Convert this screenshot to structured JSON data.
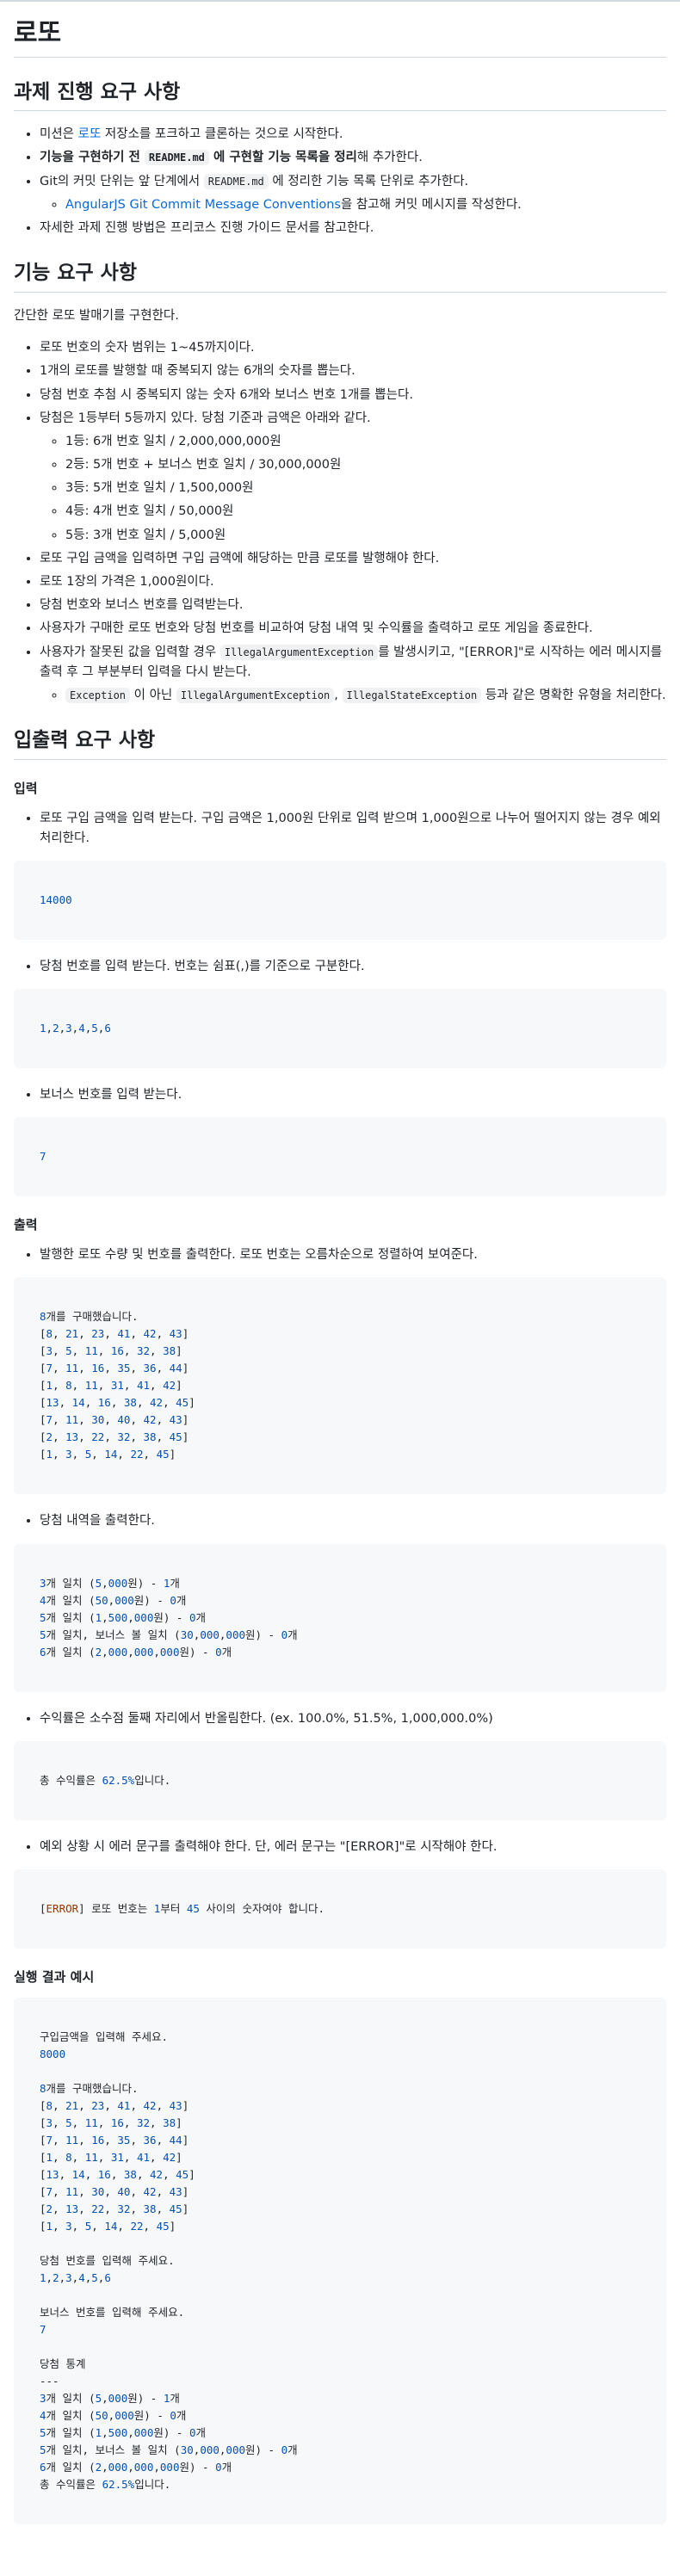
{
  "title": "로또",
  "section1": {
    "heading": "과제 진행 요구 사항",
    "items": [
      {
        "pre": "미션은 ",
        "link": "로또",
        "post": " 저장소를 포크하고 클론하는 것으로 시작한다."
      },
      {
        "pre": "기능을 구현하기 전 ",
        "code": "README.md",
        "post": " 에 구현할 기능 목록을 정리",
        "tail": "해 추가한다."
      },
      {
        "pre": "Git의 커밋 단위는 앞 단계에서 ",
        "code": "README.md",
        "post": " 에 정리한 기능 목록 단위로 추가한다."
      },
      {
        "link": "AngularJS Git Commit Message Conventions",
        "post": "을 참고해 커밋 메시지를 작성한다."
      },
      {
        "text": "자세한 과제 진행 방법은 프리코스 진행 가이드 문서를 참고한다."
      }
    ]
  },
  "section2": {
    "heading": "기능 요구 사항",
    "intro": "간단한 로또 발매기를 구현한다.",
    "items": [
      "로또 번호의 숫자 범위는 1~45까지이다.",
      "1개의 로또를 발행할 때 중복되지 않는 6개의 숫자를 뽑는다.",
      "당첨 번호 추첨 시 중복되지 않는 숫자 6개와 보너스 번호 1개를 뽑는다.",
      "당첨은 1등부터 5등까지 있다. 당첨 기준과 금액은 아래와 같다.",
      "로또 구입 금액을 입력하면 구입 금액에 해당하는 만큼 로또를 발행해야 한다.",
      "로또 1장의 가격은 1,000원이다.",
      "당첨 번호와 보너스 번호를 입력받는다.",
      "사용자가 구매한 로또 번호와 당첨 번호를 비교하여 당첨 내역 및 수익률을 출력하고 로또 게임을 종료한다.",
      "사용자가 잘못된 값을 입력할 경우 ",
      "IllegalArgumentException",
      "를 발생시키고, \"[ERROR]\"로 시작하는 에러 메시지를 출력 후 그 부분부터 입력을 다시 받는다."
    ],
    "prizes": [
      "1등: 6개 번호 일치 / 2,000,000,000원",
      "2등: 5개 번호 + 보너스 번호 일치 / 30,000,000원",
      "3등: 5개 번호 일치 / 1,500,000원",
      "4등: 4개 번호 일치 / 50,000원",
      "5등: 3개 번호 일치 / 5,000원"
    ],
    "exception_note": {
      "code1": "Exception",
      "mid1": " 이 아닌 ",
      "code2": "IllegalArgumentException",
      "sep": ", ",
      "code3": "IllegalStateException",
      "post": " 등과 같은 명확한 유형을 처리한다."
    }
  },
  "section3": {
    "heading": "입출력 요구 사항",
    "input_heading": "입력",
    "input_items": [
      "로또 구입 금액을 입력 받는다. 구입 금액은 1,000원 단위로 입력 받으며 1,000원으로 나누어 떨어지지 않는 경우 예외 처리한다.",
      "당첨 번호를 입력 받는다. 번호는 쉼표(,)를 기준으로 구분한다.",
      "보너스 번호를 입력 받는다."
    ],
    "input_code": [
      "14000",
      "1,2,3,4,5,6",
      "7"
    ],
    "output_heading": "출력",
    "output_items": [
      "발행한 로또 수량 및 번호를 출력한다. 로또 번호는 오름차순으로 정렬하여 보여준다.",
      "당첨 내역을 출력한다.",
      "수익률은 소수점 둘째 자리에서 반올림한다. (ex. 100.0%, 51.5%, 1,000,000.0%)",
      "예외 상황 시 에러 문구를 출력해야 한다. 단, 에러 문구는 \"[ERROR]\"로 시작해야 한다."
    ],
    "output_code": {
      "tickets": "8개를 구매했습니다.\n[8, 21, 23, 41, 42, 43]\n[3, 5, 11, 16, 32, 38]\n[7, 11, 16, 35, 36, 44]\n[1, 8, 11, 31, 41, 42]\n[13, 14, 16, 38, 42, 45]\n[7, 11, 30, 40, 42, 43]\n[2, 13, 22, 32, 38, 45]\n[1, 3, 5, 14, 22, 45]",
      "results": "3개 일치 (5,000원) - 1개\n4개 일치 (50,000원) - 0개\n5개 일치 (1,500,000원) - 0개\n5개 일치, 보너스 볼 일치 (30,000,000원) - 0개\n6개 일치 (2,000,000,000원) - 0개",
      "rate": "총 수익률은 62.5%입니다.",
      "error": "[ERROR] 로또 번호는 1부터 45 사이의 숫자여야 합니다."
    },
    "example_heading": "실행 결과 예시",
    "example_code": "구입금액을 입력해 주세요.\n8000\n\n8개를 구매했습니다.\n[8, 21, 23, 41, 42, 43]\n[3, 5, 11, 16, 32, 38]\n[7, 11, 16, 35, 36, 44]\n[1, 8, 11, 31, 41, 42]\n[13, 14, 16, 38, 42, 45]\n[7, 11, 30, 40, 42, 43]\n[2, 13, 22, 32, 38, 45]\n[1, 3, 5, 14, 22, 45]\n\n당첨 번호를 입력해 주세요.\n1,2,3,4,5,6\n\n보너스 번호를 입력해 주세요.\n7\n\n당첨 통계\n---\n3개 일치 (5,000원) - 1개\n4개 일치 (50,000원) - 0개\n5개 일치 (1,500,000원) - 0개\n5개 일치, 보너스 볼 일치 (30,000,000원) - 0개\n6개 일치 (2,000,000,000원) - 0개\n총 수익률은 62.5%입니다."
  },
  "colors": {
    "number": "#0550ae",
    "error": "#953800",
    "link": "#0969da",
    "code_bg": "#f6f8fa"
  }
}
